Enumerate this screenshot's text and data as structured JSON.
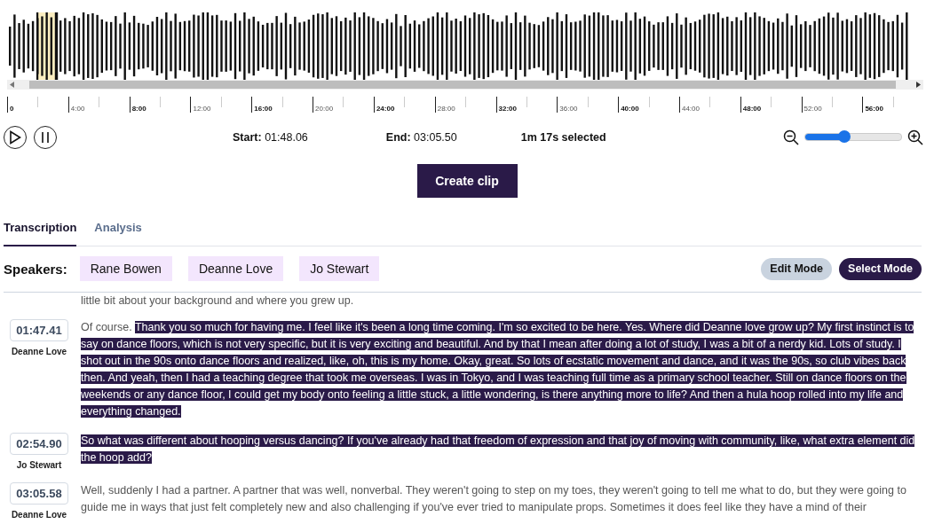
{
  "timeline": {
    "ticks": [
      {
        "label": "0",
        "emphasized": true
      },
      {
        "label": "4:00",
        "emphasized": false
      },
      {
        "label": "8:00",
        "emphasized": true
      },
      {
        "label": "12:00",
        "emphasized": false
      },
      {
        "label": "16:00",
        "emphasized": true
      },
      {
        "label": "20:00",
        "emphasized": false
      },
      {
        "label": "24:00",
        "emphasized": true
      },
      {
        "label": "28:00",
        "emphasized": false
      },
      {
        "label": "32:00",
        "emphasized": true
      },
      {
        "label": "36:00",
        "emphasized": false
      },
      {
        "label": "40:00",
        "emphasized": true
      },
      {
        "label": "44:00",
        "emphasized": false
      },
      {
        "label": "48:00",
        "emphasized": true
      },
      {
        "label": "52:00",
        "emphasized": false
      },
      {
        "label": "56:00",
        "emphasized": true
      }
    ]
  },
  "selection": {
    "start_label": "Start:",
    "start": "01:48.06",
    "end_label": "End:",
    "end": "03:05.50",
    "summary": "1m 17s selected"
  },
  "zoom": {
    "level": 0.41
  },
  "create_button": "Create clip",
  "tabs": [
    {
      "label": "Transcription",
      "selected": true
    },
    {
      "label": "Analysis",
      "selected": false
    }
  ],
  "speakers": {
    "label": "Speakers:",
    "names": [
      "Rane Bowen",
      "Deanne Love",
      "Jo Stewart"
    ]
  },
  "modes": [
    {
      "label": "Edit Mode",
      "selected": false
    },
    {
      "label": "Select Mode",
      "selected": true
    }
  ],
  "transcript": {
    "preceding_line": "little bit about your background and where you grew up.",
    "segments": [
      {
        "time": "01:47.41",
        "speaker": "Deanne Love",
        "parts": [
          {
            "text": "Of course. ",
            "selected": false
          },
          {
            "text": "Thank you so much for having me. I feel like it's been a long time coming. I'm so excited to be here. Yes. Where did Deanne love grow up? My first instinct is to say on dance floors, which is not very specific, but it is very exciting and beautiful. And by that I mean after doing a lot of study, I was a bit of a nerdy kid. Lots of study. I shot out in the 90s onto dance floors and realized, like, oh, this is my home. Okay, great. So lots of ecstatic movement and dance, and it was the 90s, so club vibes back then. And yeah, then I had a teaching degree that took me overseas. I was in Tokyo, and I was teaching full time as a primary school teacher. Still on dance floors on the weekends or any dance floor, I could get my body onto feeling a little stuck, a little wondering, is there anything more to life? And then a hula hoop rolled into my life and everything changed.",
            "selected": true
          }
        ]
      },
      {
        "time": "02:54.90",
        "speaker": "Jo Stewart",
        "parts": [
          {
            "text": "So what was different about hooping versus dancing? If you've already had that freedom of expression and that joy of moving with community, like, what extra element did the hoop add?",
            "selected": true
          }
        ]
      },
      {
        "time": "03:05.58",
        "speaker": "Deanne Love",
        "parts": [
          {
            "text": "Well, suddenly I had a partner. A partner that was well, nonverbal. They weren't going to step on my toes, they weren't going to tell me what to do, but they were going to guide me in ways that just felt completely new and also challenging if you've ever tried to manipulate props. Sometimes it does feel like they have a mind of their",
            "selected": false
          }
        ]
      }
    ]
  }
}
